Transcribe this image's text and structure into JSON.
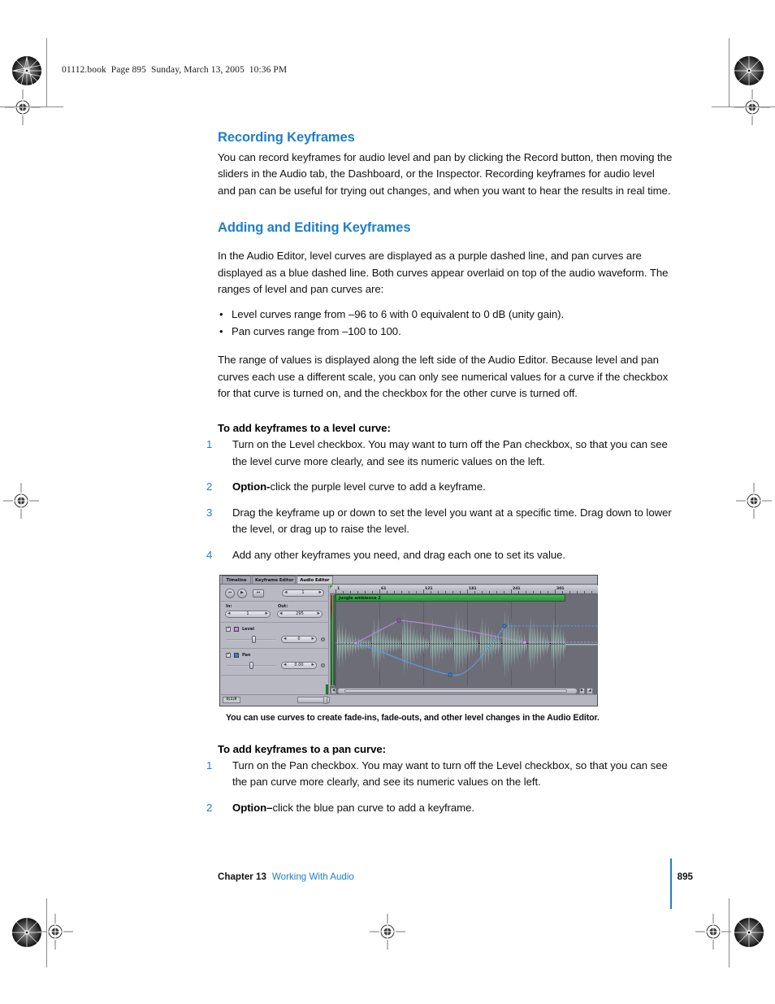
{
  "slug": "01112.book  Page 895  Sunday, March 13, 2005  10:36 PM",
  "sections": {
    "recording": {
      "heading": "Recording Keyframes",
      "paragraph": "You can record keyframes for audio level and pan by clicking the Record button, then moving the sliders in the Audio tab, the Dashboard, or the Inspector. Recording keyframes for audio level and pan can be useful for trying out changes, and when you want to hear the results in real time."
    },
    "adding": {
      "heading": "Adding and Editing Keyframes",
      "paragraph": "In the Audio Editor, level curves are displayed as a purple dashed line, and pan curves are displayed as a blue dashed line. Both curves appear overlaid on top of the audio waveform. The ranges of level and pan curves are:",
      "bullets": [
        "Level curves range from –96 to 6 with 0 equivalent to 0 dB (unity gain).",
        "Pan curves range from –100 to 100."
      ],
      "paragraph2": "The range of values is displayed along the left side of the Audio Editor. Because level and pan curves each use a different scale, you can only see numerical values for a curve if the checkbox for that curve is turned on, and the checkbox for the other curve is turned off."
    },
    "level_proc": {
      "heading": "To add keyframes to a level curve:",
      "steps": [
        {
          "num": "1",
          "bold": "",
          "text": "Turn on the Level checkbox. You may want to turn off the Pan checkbox, so that you can see the level curve more clearly, and see its numeric values on the left."
        },
        {
          "num": "2",
          "bold": "Option-",
          "text": "click the purple level curve to add a keyframe."
        },
        {
          "num": "3",
          "bold": "",
          "text": "Drag the keyframe up or down to set the level you want at a specific time. Drag down to lower the level, or drag up to raise the level."
        },
        {
          "num": "4",
          "bold": "",
          "text": "Add any other keyframes you need, and drag each one to set its value."
        }
      ]
    },
    "pan_proc": {
      "heading": "To add keyframes to a pan curve:",
      "steps": [
        {
          "num": "1",
          "bold": "",
          "text": "Turn on the Pan checkbox. You may want to turn off the Level checkbox, so that you can see the pan curve more clearly, and see its numeric values on the left."
        },
        {
          "num": "2",
          "bold": "Option–",
          "text": "click the blue pan curve to add a keyframe."
        }
      ]
    },
    "figure_caption": "You can use curves to create fade-ins, fade-outs, and other level changes in the Audio Editor."
  },
  "audio_editor": {
    "tabs": [
      {
        "label": "Timeline",
        "active": false
      },
      {
        "label": "Keyframe Editor",
        "active": false
      },
      {
        "label": "Audio Editor",
        "active": true
      }
    ],
    "transport": {
      "go_to_start_icon": "skip-to-start-icon",
      "play_icon": "play-icon",
      "marker_icon": "marker-icon",
      "frame_value": "1"
    },
    "in_label": "In:",
    "in_value": "1",
    "out_label": "Out:",
    "out_value": "295",
    "level": {
      "label": "Level",
      "checked": true,
      "swatch_color": "#cc8fe0",
      "value": "0"
    },
    "pan": {
      "label": "Pan",
      "checked": true,
      "swatch_color": "#3a7fd5",
      "value": "0.00"
    },
    "clip_name": "Jungle ambience 2",
    "ruler_labels": [
      "1",
      "61",
      "121",
      "181",
      "241",
      "301"
    ],
    "timecode": "0;1;9",
    "colors": {
      "waveform": "#a9ddc6",
      "background": "#6d6d78",
      "level_curve": "#b98fd6",
      "pan_curve": "#5b9fe0",
      "clip_bar": "#3a9d4a"
    }
  },
  "footer": {
    "chapter": "Chapter 13",
    "chapter_title": "Working With Audio",
    "page_number": "895"
  }
}
